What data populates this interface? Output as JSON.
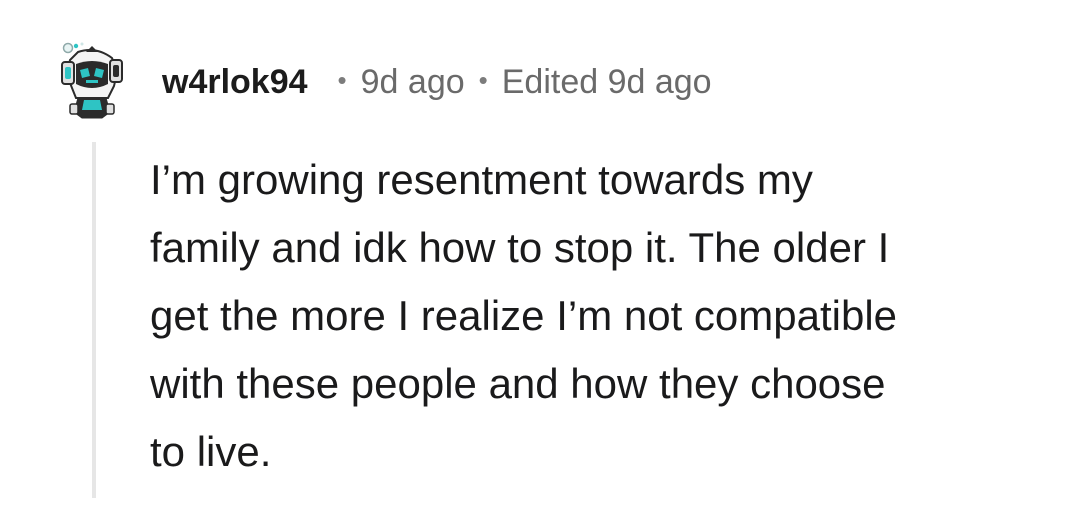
{
  "comment": {
    "author": "w4rlok94",
    "separator": "•",
    "time": "9d ago",
    "edited": "Edited 9d ago",
    "body_lines": [
      "I’m growing resentment towards my",
      "family and idk how to stop it. The older I",
      "get the more I realize I’m not compatible",
      "with these people and how they choose",
      "to live."
    ],
    "avatar": {
      "icon": "robot-avatar-icon",
      "colors": {
        "accent": "#2ec4c4",
        "dark": "#2b2b2b",
        "light": "#f2f2f2"
      }
    }
  }
}
